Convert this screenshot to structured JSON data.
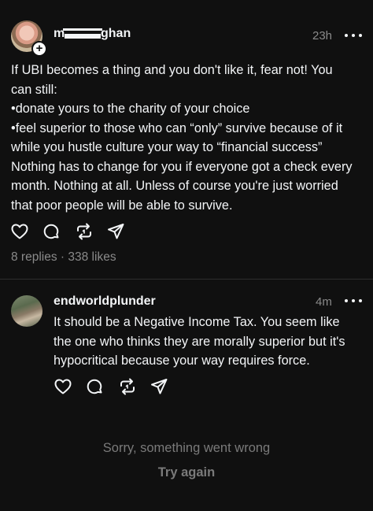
{
  "main_post": {
    "username_partial_left": "m",
    "username_partial_right": "ghan",
    "time": "23h",
    "lines": [
      "If UBI becomes a thing and you don't like it, fear not! You",
      "can still:",
      "•donate yours to the charity of your choice",
      "•feel superior to those who can “only” survive because of it",
      "while you hustle culture your way to “financial success”",
      "Nothing has to change for you if everyone got a check every",
      "month. Nothing at all. Unless of course you're just worried",
      "that poor people will be able to survive."
    ],
    "replies": "8 replies",
    "separator": "·",
    "likes": "338 likes"
  },
  "reply_post": {
    "username": "endworldplunder",
    "time": "4m",
    "lines": [
      "It should be a Negative Income Tax. You seem like",
      "the one who thinks they are morally superior but it's",
      "hypocritical because your way requires force."
    ]
  },
  "error": {
    "message": "Sorry, something went wrong",
    "retry_label": "Try again"
  },
  "icons": {
    "like": "heart-icon",
    "reply": "comment-icon",
    "repost": "repost-icon",
    "share": "send-icon",
    "more": "more-icon",
    "follow": "plus-icon"
  },
  "colors": {
    "background": "#101010",
    "text": "#f3f5f7",
    "secondary": "#8a8a8a",
    "divider": "#2e2e2e"
  }
}
